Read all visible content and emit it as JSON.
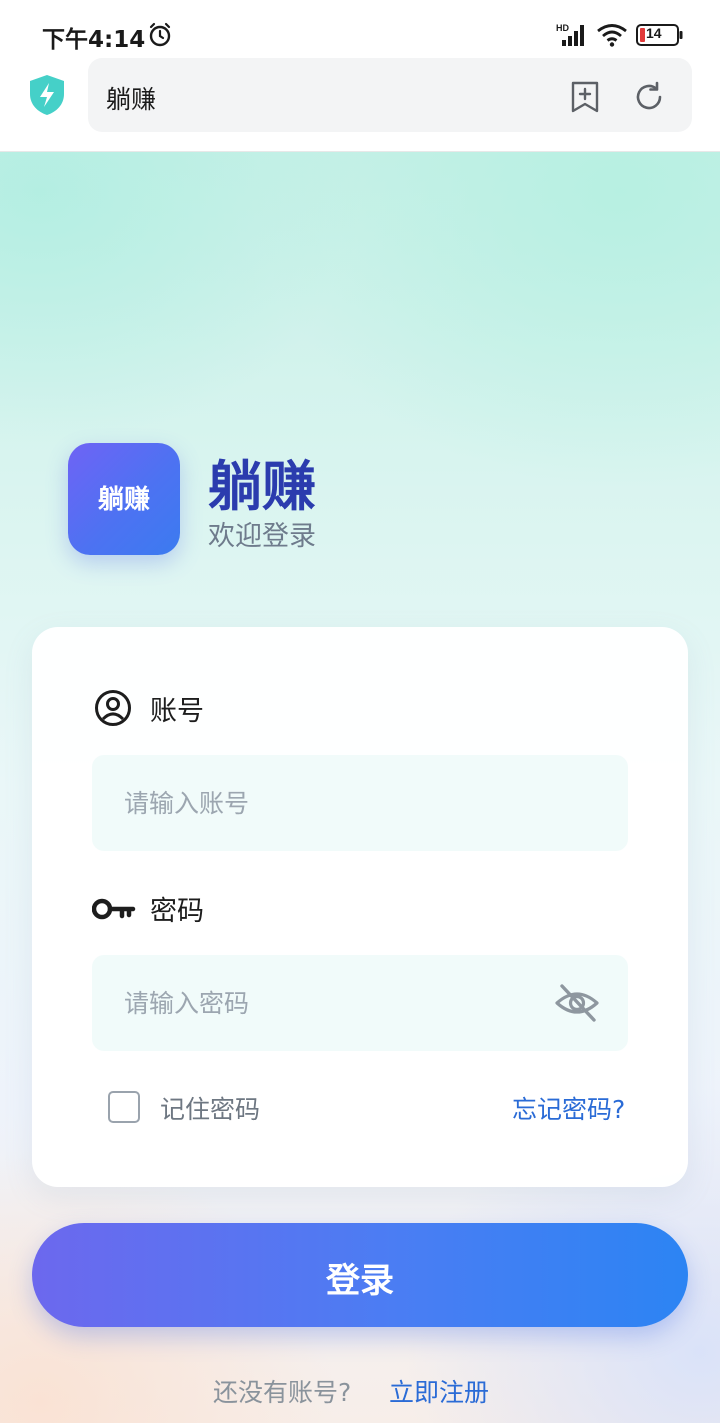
{
  "status_bar": {
    "time": "下午4:14",
    "battery": "14",
    "network": "HD"
  },
  "browser": {
    "url_title": "躺赚"
  },
  "brand": {
    "logo_text": "躺赚",
    "app_name": "躺赚",
    "tagline": "欢迎登录"
  },
  "form": {
    "account_label": "账号",
    "account_placeholder": "请输入账号",
    "account_value": "",
    "password_label": "密码",
    "password_placeholder": "请输入密码",
    "password_value": "",
    "remember_label": "记住密码",
    "remember_checked": false,
    "forgot_label": "忘记密码?"
  },
  "actions": {
    "login_label": "登录",
    "register_prompt": "还没有账号?",
    "register_link": "立即注册"
  },
  "colors": {
    "brand_blue": "#2b3cae",
    "link_blue": "#2a6bd6",
    "button_gradient_start": "#6c68ee",
    "button_gradient_end": "#2c84f3",
    "shield_teal": "#3fcfcf"
  },
  "icons": [
    "alarm-icon",
    "signal-icon",
    "wifi-icon",
    "battery-icon",
    "shield-icon",
    "bookmark-add-icon",
    "refresh-icon",
    "user-icon",
    "key-icon",
    "eye-off-icon"
  ]
}
